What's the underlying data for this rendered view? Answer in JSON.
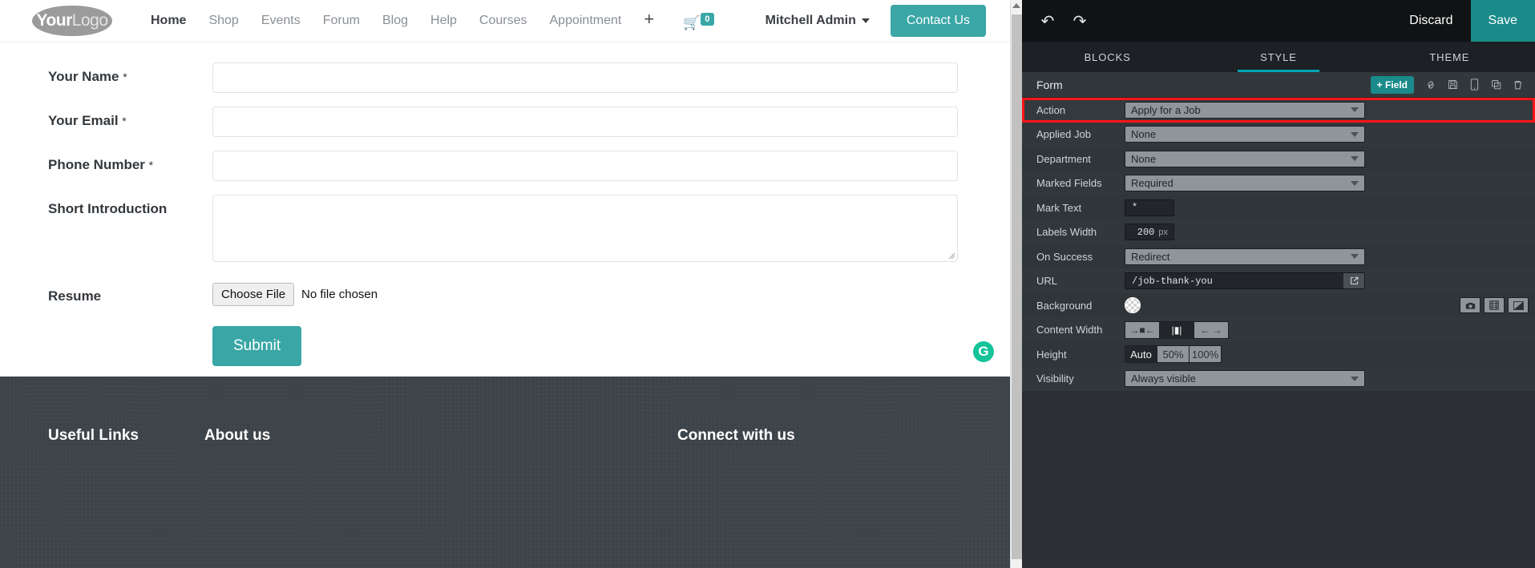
{
  "site": {
    "logo": {
      "bold": "Your",
      "light": "Logo"
    },
    "nav": [
      {
        "label": "Home",
        "active": true
      },
      {
        "label": "Shop",
        "active": false
      },
      {
        "label": "Events",
        "active": false
      },
      {
        "label": "Forum",
        "active": false
      },
      {
        "label": "Blog",
        "active": false
      },
      {
        "label": "Help",
        "active": false
      },
      {
        "label": "Courses",
        "active": false
      },
      {
        "label": "Appointment",
        "active": false
      }
    ],
    "add_page_icon": "plus-icon",
    "cart": {
      "icon": "shopping-cart-icon",
      "count": "0"
    },
    "user": "Mitchell Admin",
    "contact_button": "Contact Us"
  },
  "form": {
    "fields": [
      {
        "label": "Your Name",
        "mark": "*",
        "type": "text"
      },
      {
        "label": "Your Email",
        "mark": "*",
        "type": "text"
      },
      {
        "label": "Phone Number",
        "mark": "*",
        "type": "text"
      },
      {
        "label": "Short Introduction",
        "mark": "",
        "type": "textarea"
      },
      {
        "label": "Resume",
        "mark": "",
        "type": "file"
      }
    ],
    "file": {
      "button": "Choose File",
      "status": "No file chosen"
    },
    "submit": "Submit"
  },
  "footer": {
    "columns": [
      {
        "title": "Useful Links"
      },
      {
        "title": "About us"
      },
      {
        "title": "Connect with us"
      }
    ]
  },
  "grammarly": {
    "icon": "grammarly-icon",
    "glyph": "G"
  },
  "editor": {
    "toolbar": {
      "undo_icon": "undo-icon",
      "redo_icon": "redo-icon",
      "discard": "Discard",
      "save": "Save"
    },
    "tabs": [
      {
        "label": "BLOCKS",
        "active": false
      },
      {
        "label": "STYLE",
        "active": true
      },
      {
        "label": "THEME",
        "active": false
      }
    ],
    "block": {
      "title": "Form",
      "add_field": "+ Field",
      "tools": [
        {
          "name": "link-icon",
          "glyph": "✂"
        },
        {
          "name": "save-snippet-icon",
          "glyph": "ὋE"
        },
        {
          "name": "mobile-preview-icon",
          "glyph": "▯"
        },
        {
          "name": "duplicate-icon",
          "glyph": "⧉"
        },
        {
          "name": "delete-icon",
          "glyph": "Ὕ1"
        }
      ]
    },
    "options": [
      {
        "label": "Action",
        "kind": "select",
        "value": "Apply for a Job",
        "highlighted": true
      },
      {
        "label": "Applied Job",
        "kind": "select",
        "value": "None"
      },
      {
        "label": "Department",
        "kind": "select",
        "value": "None"
      },
      {
        "label": "Marked Fields",
        "kind": "select",
        "value": "Required"
      },
      {
        "label": "Mark Text",
        "kind": "text",
        "value": "*"
      },
      {
        "label": "Labels Width",
        "kind": "number",
        "value": "200",
        "unit": "px"
      },
      {
        "label": "On Success",
        "kind": "select",
        "value": "Redirect"
      },
      {
        "label": "URL",
        "kind": "url",
        "value": "/job-thank-you",
        "action_icon": "open-external-icon"
      },
      {
        "label": "Background",
        "kind": "background",
        "swatch": "transparent",
        "buttons": [
          {
            "name": "image-icon",
            "glyph": "὏7"
          },
          {
            "name": "video-icon",
            "glyph": "ἹE"
          },
          {
            "name": "gradient-icon",
            "glyph": "◥"
          }
        ]
      },
      {
        "label": "Content Width",
        "kind": "segment",
        "items": [
          {
            "name": "width-narrow-icon",
            "glyph": "→■←",
            "active": false
          },
          {
            "name": "width-normal-icon",
            "glyph": "|▮|",
            "active": true
          },
          {
            "name": "width-full-icon",
            "glyph": "← →",
            "active": false
          }
        ]
      },
      {
        "label": "Height",
        "kind": "segment",
        "items": [
          {
            "name": "height-auto-option",
            "glyph": "Auto",
            "active": true
          },
          {
            "name": "height-50-option",
            "glyph": "50%",
            "active": false
          },
          {
            "name": "height-100-option",
            "glyph": "100%",
            "active": false
          }
        ]
      },
      {
        "label": "Visibility",
        "kind": "select",
        "value": "Always visible"
      }
    ]
  }
}
